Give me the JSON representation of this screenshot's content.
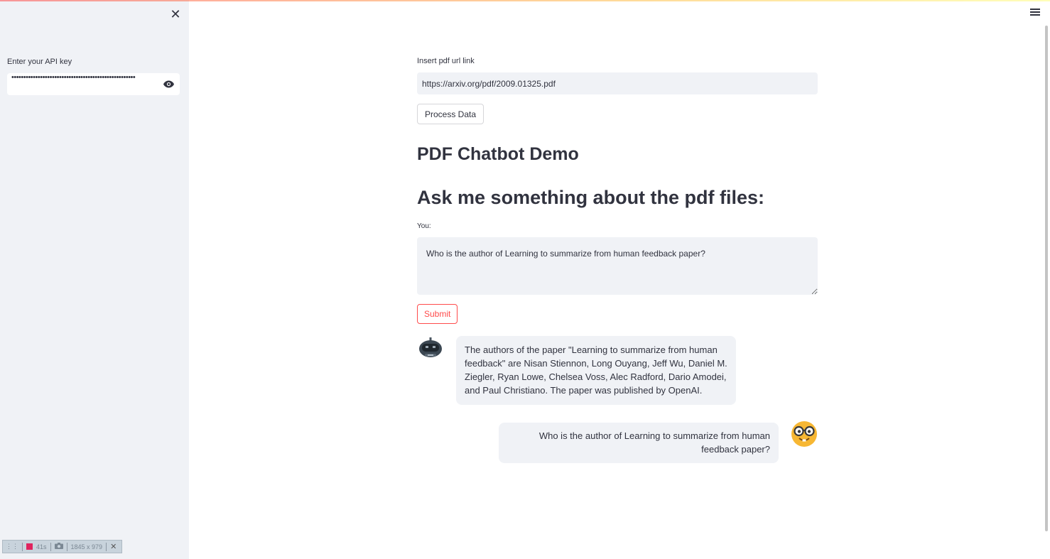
{
  "sidebar": {
    "close_label": "✕",
    "api_label": "Enter your API key",
    "api_value": "••••••••••••••••••••••••••••••••••••••••••••••••••••"
  },
  "devbar": {
    "timer": "41s",
    "resolution": "1845 x 979",
    "close_label": "✕"
  },
  "main": {
    "pdf_label": "Insert pdf url link",
    "pdf_value": "https://arxiv.org/pdf/2009.01325.pdf",
    "process_label": "Process Data",
    "title": "PDF Chatbot Demo",
    "ask_heading": "Ask me something about the pdf files:",
    "you_label": "You:",
    "you_value": "Who is the author of Learning to summarize from human feedback paper?",
    "submit_label": "Submit"
  },
  "chat": {
    "bot_message": "The authors of the paper \"Learning to summarize from human feedback\" are Nisan Stiennon, Long Ouyang, Jeff Wu, Daniel M. Ziegler, Ryan Lowe, Chelsea Voss, Alec Radford, Dario Amodei, and Paul Christiano. The paper was published by OpenAI.",
    "user_message": "Who is the author of Learning to summarize from human feedback paper?"
  },
  "colors": {
    "primary": "#ff4b4b",
    "sidebar_bg": "#f0f2f6",
    "text": "#31333f"
  },
  "icons": {
    "close": "close-icon",
    "eye": "eye-icon",
    "menu": "hamburger-menu-icon",
    "bot": "bot-avatar-icon",
    "user": "nerd-face-avatar-icon"
  }
}
